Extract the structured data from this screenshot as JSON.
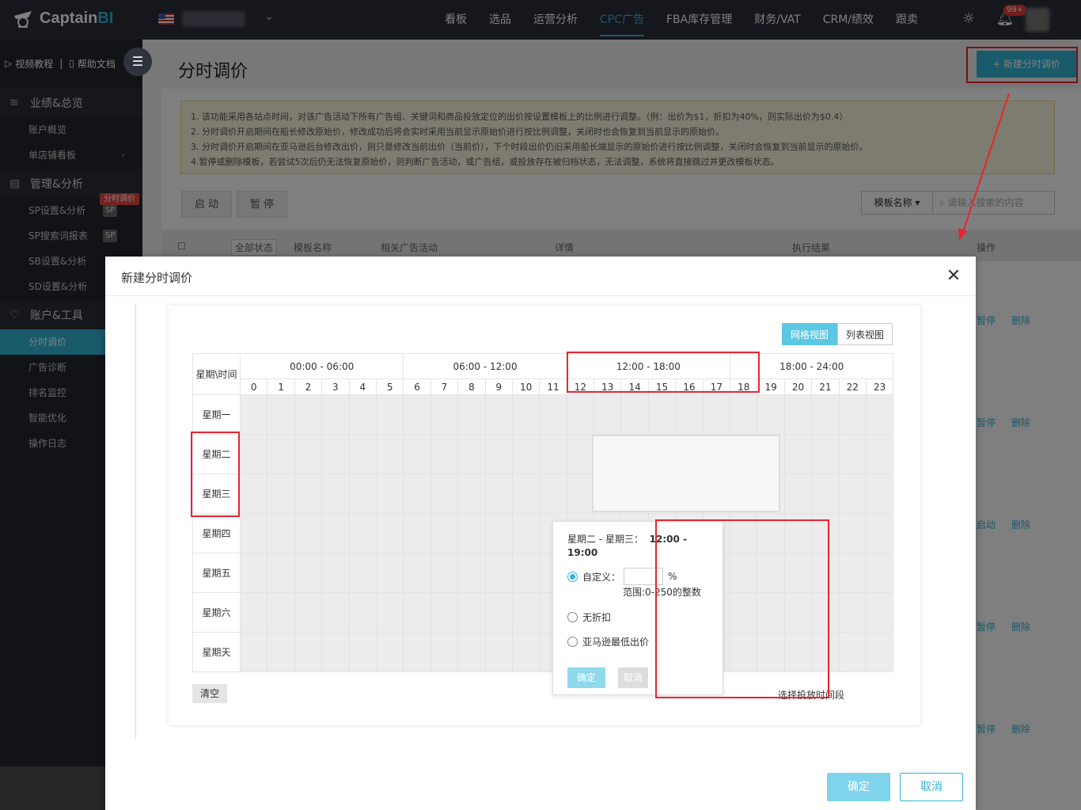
{
  "brand": {
    "name": "Captain",
    "suffix": "BI"
  },
  "nav": {
    "items": [
      "看板",
      "选品",
      "运营分析",
      "CPC广告",
      "FBA库存管理",
      "财务/VAT",
      "CRM/绩效",
      "跟卖"
    ],
    "active_index": 3,
    "notification_count": "99+"
  },
  "sidebar": {
    "video": "视频教程",
    "help": "帮助文档",
    "groups": [
      {
        "label": "业绩&总览",
        "icon": "layers-icon",
        "items": [
          {
            "label": "账户概览"
          },
          {
            "label": "单店铺看板",
            "chevron": true
          }
        ]
      },
      {
        "label": "管理&分析",
        "icon": "chart-icon",
        "items": [
          {
            "label": "SP设置&分析",
            "tag": "SP"
          },
          {
            "label": "SP搜索词报表",
            "tag": "SP"
          },
          {
            "label": "SB设置&分析"
          },
          {
            "label": "SD设置&分析"
          }
        ]
      },
      {
        "label": "账户&工具",
        "icon": "heart-icon",
        "items": [
          {
            "label": "分时调价",
            "active": true
          },
          {
            "label": "广告诊断"
          },
          {
            "label": "排名监控"
          },
          {
            "label": "智能优化"
          },
          {
            "label": "操作日志"
          }
        ]
      }
    ],
    "hot_tag": "分时调价"
  },
  "page": {
    "title": "分时调价",
    "new_button": "+ 新建分时调价",
    "notice": [
      "1. 该功能采用各站点时间，对该广告活动下所有广告组、关键词和商品投放定位的出价按设置模板上的比例进行调整。（例：出价为$1，折扣为40%，则实际出价为$0.4）",
      "2. 分时调价开启期间在船长修改原始价，修改成功后将会实时采用当前显示原始价进行按比例调整，关闭时也会恢复到当前显示的原始价。",
      "3. 分时调价开启期间在亚马逊后台修改出价，则只是修改当前出价（当前价），下个时段出价仍旧采用船长端显示的原始价进行按比例调整，关闭时会恢复到当前显示的原始价。",
      "4.暂停或删除模板，若尝试5次后仍无法恢复原始价，则判断广告活动，或广告组，或投放存在被归档状态，无法调整，系统将直接跳过并更改模板状态。"
    ],
    "start": "启 动",
    "pause": "暂 停",
    "search_select": "模板名称",
    "search_placeholder": "请输入搜索的内容",
    "table_headers": [
      "全部状态",
      "模板名称",
      "相关广告活动",
      "详情",
      "执行结果",
      "操作"
    ],
    "row_actions": [
      [
        "暂停",
        "删除"
      ],
      [
        "暂停",
        "删除"
      ],
      [
        "启动",
        "删除"
      ],
      [
        "暂停",
        "删除"
      ],
      [
        "暂停",
        "删除"
      ]
    ]
  },
  "modal": {
    "title": "新建分时调价",
    "view_grid": "网格视图",
    "view_list": "列表视图",
    "corner": "星期\\时间",
    "ranges": [
      "00:00 - 06:00",
      "06:00 - 12:00",
      "12:00 - 18:00",
      "18:00 - 24:00"
    ],
    "hours": [
      "0",
      "1",
      "2",
      "3",
      "4",
      "5",
      "6",
      "7",
      "8",
      "9",
      "10",
      "11",
      "12",
      "13",
      "14",
      "15",
      "16",
      "17",
      "18",
      "19",
      "20",
      "21",
      "22",
      "23"
    ],
    "days": [
      "星期一",
      "星期二",
      "星期三",
      "星期四",
      "星期五",
      "星期六",
      "星期天"
    ],
    "clear": "清空",
    "hint": "选择投放时间段",
    "ok": "确定",
    "cancel": "取消"
  },
  "popup": {
    "range": "星期二 - 星期三：",
    "time": "12:00 - 19:00",
    "custom": "自定义：",
    "pct": "%",
    "range_hint": "范围:0-250的整数",
    "no_discount": "无折扣",
    "amazon_min": "亚马逊最低出价",
    "ok": "确定",
    "cancel": "取消"
  },
  "colors": {
    "accent": "#33b4d6",
    "annotation": "#e8252f"
  }
}
